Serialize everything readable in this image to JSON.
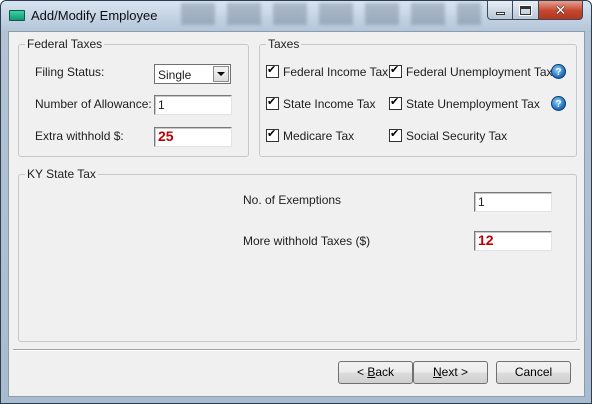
{
  "window": {
    "title": "Add/Modify Employee"
  },
  "federal_taxes": {
    "legend": "Federal Taxes",
    "filing_status_label": "Filing Status:",
    "filing_status_value": "Single",
    "allowance_label": "Number of Allowance:",
    "allowance_value": "1",
    "extra_withhold_label": "Extra withhold $:",
    "extra_withhold_value": "25"
  },
  "taxes": {
    "legend": "Taxes",
    "items": [
      {
        "label": "Federal Income Tax",
        "checked": true
      },
      {
        "label": "Federal Unemployment Tax",
        "checked": true
      },
      {
        "label": "State Income Tax",
        "checked": true
      },
      {
        "label": "State Unemployment Tax",
        "checked": true
      },
      {
        "label": "Medicare Tax",
        "checked": true
      },
      {
        "label": "Social Security Tax",
        "checked": true
      }
    ]
  },
  "state_tax": {
    "legend": "KY State Tax",
    "exemptions_label": "No. of Exemptions",
    "exemptions_value": "1",
    "more_withhold_label": "More withhold Taxes ($)",
    "more_withhold_value": "12"
  },
  "buttons": {
    "back_prefix": "< ",
    "back_access": "B",
    "back_rest": "ack",
    "next_access": "N",
    "next_rest": "ext >",
    "cancel": "Cancel"
  },
  "colors": {
    "accent_value_red": "#c00000",
    "close_button": "#c4462f"
  }
}
